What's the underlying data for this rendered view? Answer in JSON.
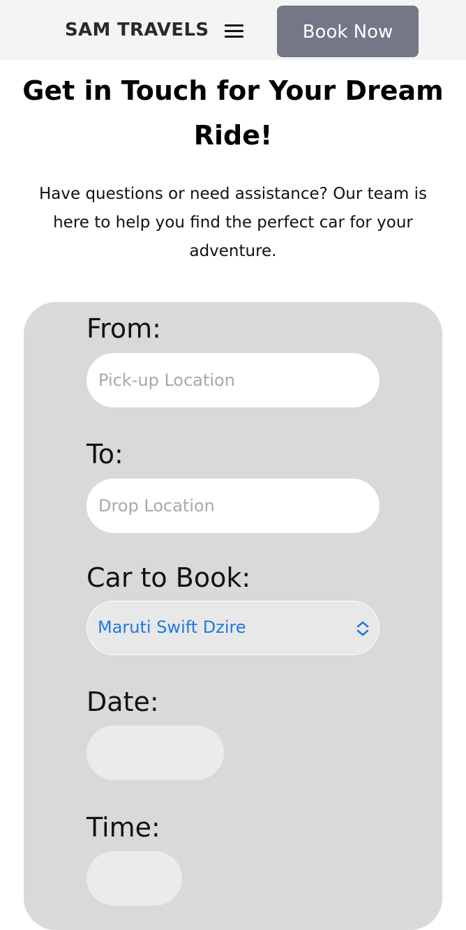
{
  "header": {
    "brand": "SAM TRAVELS",
    "book_button_label": "Book Now",
    "menu_icon": "hamburger-menu-icon"
  },
  "hero": {
    "title": "Get in Touch for Your Dream Ride!",
    "description": "Have questions or need assistance? Our team is here to help you find the perfect car for your adventure."
  },
  "form": {
    "from_label": "From:",
    "from_placeholder": "Pick-up Location",
    "to_label": "To:",
    "to_placeholder": "Drop Location",
    "car_label": "Car to Book:",
    "car_selected": "Maruti Swift Dzire",
    "date_label": "Date:",
    "date_value": "",
    "time_label": "Time:",
    "time_value": ""
  },
  "colors": {
    "nav_background": "#f4f4f4",
    "book_button": "#737786",
    "form_background": "#d9d9db",
    "select_text": "#1f7ae0"
  }
}
